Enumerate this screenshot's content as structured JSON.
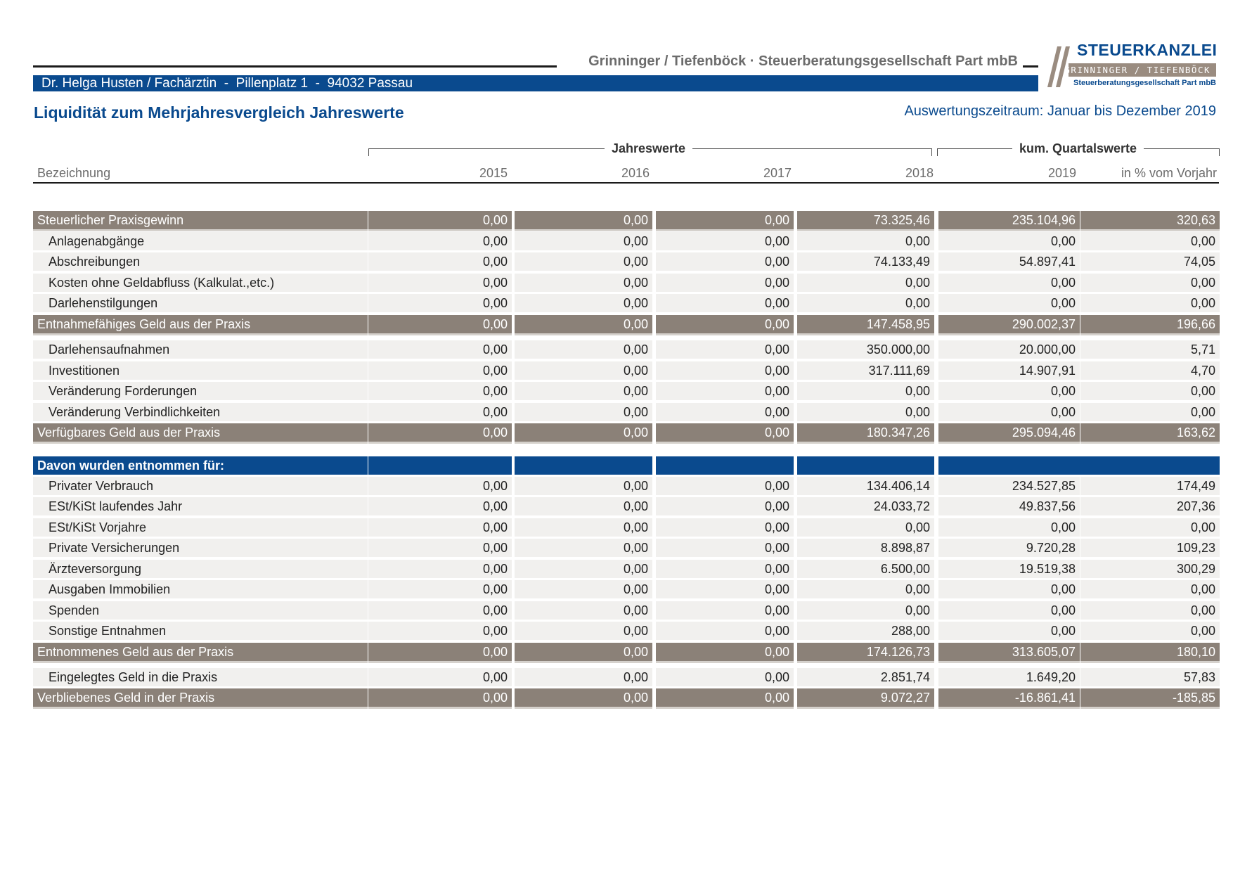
{
  "header": {
    "firm": "Grinninger / Tiefenböck · Steuerberatungsgesellschaft Part mbB",
    "client": "Dr. Helga Husten / Fachärztin  -  Pillenplatz 1  -  94032 Passau"
  },
  "logo": {
    "title": "STEUERKANZLEI",
    "band": "GRINNINGER / TIEFENBÖCK",
    "sub": "Steuerberatungsgesellschaft Part mbB"
  },
  "report": {
    "title": "Liquidität zum Mehrjahresvergleich Jahreswerte",
    "period": "Auswertungszeitraum: Januar bis Dezember 2019"
  },
  "table": {
    "group_headers": [
      "Jahreswerte",
      "kum. Quartalswerte"
    ],
    "columns": [
      "Bezeichnung",
      "2015",
      "2016",
      "2017",
      "2018",
      "2019",
      "in % vom Vorjahr"
    ],
    "rows": [
      {
        "type": "total",
        "label": "Steuerlicher Praxisgewinn",
        "values": [
          "0,00",
          "0,00",
          "0,00",
          "73.325,46",
          "235.104,96",
          "320,63"
        ]
      },
      {
        "type": "normal",
        "label": "Anlagenabgänge",
        "values": [
          "0,00",
          "0,00",
          "0,00",
          "0,00",
          "0,00",
          "0,00"
        ]
      },
      {
        "type": "normal",
        "label": "Abschreibungen",
        "values": [
          "0,00",
          "0,00",
          "0,00",
          "74.133,49",
          "54.897,41",
          "74,05"
        ]
      },
      {
        "type": "normal",
        "label": "Kosten ohne Geldabfluss (Kalkulat.,etc.)",
        "values": [
          "0,00",
          "0,00",
          "0,00",
          "0,00",
          "0,00",
          "0,00"
        ]
      },
      {
        "type": "normal",
        "label": "Darlehenstilgungen",
        "values": [
          "0,00",
          "0,00",
          "0,00",
          "0,00",
          "0,00",
          "0,00"
        ]
      },
      {
        "type": "total",
        "label": "Entnahmefähiges Geld aus der Praxis",
        "values": [
          "0,00",
          "0,00",
          "0,00",
          "147.458,95",
          "290.002,37",
          "196,66"
        ]
      },
      {
        "type": "normal",
        "label": "Darlehensaufnahmen",
        "values": [
          "0,00",
          "0,00",
          "0,00",
          "350.000,00",
          "20.000,00",
          "5,71"
        ]
      },
      {
        "type": "normal",
        "label": "Investitionen",
        "values": [
          "0,00",
          "0,00",
          "0,00",
          "317.111,69",
          "14.907,91",
          "4,70"
        ]
      },
      {
        "type": "normal",
        "label": "Veränderung Forderungen",
        "values": [
          "0,00",
          "0,00",
          "0,00",
          "0,00",
          "0,00",
          "0,00"
        ]
      },
      {
        "type": "normal",
        "label": "Veränderung Verbindlichkeiten",
        "values": [
          "0,00",
          "0,00",
          "0,00",
          "0,00",
          "0,00",
          "0,00"
        ]
      },
      {
        "type": "total",
        "label": "Verfügbares Geld aus der Praxis",
        "values": [
          "0,00",
          "0,00",
          "0,00",
          "180.347,26",
          "295.094,46",
          "163,62"
        ]
      },
      {
        "type": "section",
        "label": "Davon wurden entnommen für:",
        "values": [
          "",
          "",
          "",
          "",
          "",
          ""
        ]
      },
      {
        "type": "normal",
        "label": "Privater Verbrauch",
        "values": [
          "0,00",
          "0,00",
          "0,00",
          "134.406,14",
          "234.527,85",
          "174,49"
        ]
      },
      {
        "type": "normal",
        "label": "ESt/KiSt laufendes Jahr",
        "values": [
          "0,00",
          "0,00",
          "0,00",
          "24.033,72",
          "49.837,56",
          "207,36"
        ]
      },
      {
        "type": "normal",
        "label": "ESt/KiSt Vorjahre",
        "values": [
          "0,00",
          "0,00",
          "0,00",
          "0,00",
          "0,00",
          "0,00"
        ]
      },
      {
        "type": "normal",
        "label": "Private Versicherungen",
        "values": [
          "0,00",
          "0,00",
          "0,00",
          "8.898,87",
          "9.720,28",
          "109,23"
        ]
      },
      {
        "type": "normal",
        "label": "Ärzteversorgung",
        "values": [
          "0,00",
          "0,00",
          "0,00",
          "6.500,00",
          "19.519,38",
          "300,29"
        ]
      },
      {
        "type": "normal",
        "label": "Ausgaben Immobilien",
        "values": [
          "0,00",
          "0,00",
          "0,00",
          "0,00",
          "0,00",
          "0,00"
        ]
      },
      {
        "type": "normal",
        "label": "Spenden",
        "values": [
          "0,00",
          "0,00",
          "0,00",
          "0,00",
          "0,00",
          "0,00"
        ]
      },
      {
        "type": "normal",
        "label": "Sonstige Entnahmen",
        "values": [
          "0,00",
          "0,00",
          "0,00",
          "288,00",
          "0,00",
          "0,00"
        ]
      },
      {
        "type": "total",
        "label": "Entnommenes Geld aus der Praxis",
        "values": [
          "0,00",
          "0,00",
          "0,00",
          "174.126,73",
          "313.605,07",
          "180,10"
        ]
      },
      {
        "type": "normal",
        "label": "Eingelegtes Geld in die Praxis",
        "values": [
          "0,00",
          "0,00",
          "0,00",
          "2.851,74",
          "1.649,20",
          "57,83"
        ]
      },
      {
        "type": "total",
        "label": "Verbliebenes Geld in der Praxis",
        "values": [
          "0,00",
          "0,00",
          "0,00",
          "9.072,27",
          "-16.861,41",
          "-185,85"
        ]
      }
    ]
  }
}
